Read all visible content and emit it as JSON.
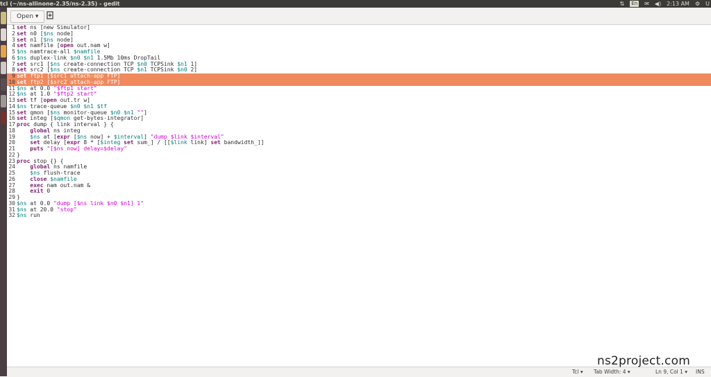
{
  "window": {
    "title": "tcl (~/ns-allinone-2.35/ns-2.35) - gedit"
  },
  "tray": {
    "clock": "2:13 AM",
    "lang": "En",
    "user": "U",
    "net_icon": "network-arrows-icon",
    "mail_icon": "mail-icon",
    "volume_icon": "volume-icon"
  },
  "toolbar": {
    "open_label": "Open ▾",
    "new_icon": "new-document-icon"
  },
  "editor": {
    "lines": [
      {
        "n": "1",
        "t": "set ns [new Simulator]"
      },
      {
        "n": "2",
        "t": "set n0 [$ns node]"
      },
      {
        "n": "3",
        "t": "set n1 [$ns node]"
      },
      {
        "n": "4",
        "t": "set namfile [open out.nam w]"
      },
      {
        "n": "5",
        "t": "$ns namtrace-all $namfile"
      },
      {
        "n": "6",
        "t": "$ns duplex-link $n0 $n1 1.5Mb 10ms DropTail"
      },
      {
        "n": "7",
        "t": "set src1 [$ns create-connection TCP $n0 TCPSink $n1 1]"
      },
      {
        "n": "8",
        "t": "set src2 [$ns create-connection TCP $n1 TCPSink $n0 2]"
      },
      {
        "n": "9",
        "t": "set ftp1 [$src1 attach-app FTP]"
      },
      {
        "n": "10",
        "t": "set ftp2 [$src2 attach-app FTP]"
      },
      {
        "n": "11",
        "t": "$ns at 0.0 \"$ftp1 start\""
      },
      {
        "n": "12",
        "t": "$ns at 1.0 \"$ftp2 start\""
      },
      {
        "n": "13",
        "t": "set tf [open out.tr w]"
      },
      {
        "n": "14",
        "t": "$ns trace-queue $n0 $n1 $tf"
      },
      {
        "n": "15",
        "t": "set qmon [$ns monitor-queue $n0 $n1 \"\"]"
      },
      {
        "n": "16",
        "t": "set integ [$qmon get-bytes-integrator]"
      },
      {
        "n": "17",
        "t": "proc dump { link interval } {"
      },
      {
        "n": "18",
        "t": "    global ns integ"
      },
      {
        "n": "19",
        "t": "    $ns at [expr [$ns now] + $interval] \"dump $link $interval\""
      },
      {
        "n": "20",
        "t": "    set delay [expr 8 * [$integ set sum_] / [[$link link] set bandwidth_]]"
      },
      {
        "n": "21",
        "t": "    puts \"[$ns now] delay=$delay\""
      },
      {
        "n": "22",
        "t": "}"
      },
      {
        "n": "23",
        "t": "proc stop {} {"
      },
      {
        "n": "24",
        "t": "    global ns namfile"
      },
      {
        "n": "25",
        "t": "    $ns flush-trace"
      },
      {
        "n": "26",
        "t": "    close $namfile"
      },
      {
        "n": "27",
        "t": "    exec nam out.nam &"
      },
      {
        "n": "28",
        "t": "    exit 0"
      },
      {
        "n": "29",
        "t": "}"
      },
      {
        "n": "30",
        "t": "$ns at 0.0 \"dump [$ns link $n0 $n1] 1\""
      },
      {
        "n": "31",
        "t": "$ns at 20.0 \"stop\""
      },
      {
        "n": "32",
        "t": "$ns run"
      }
    ],
    "current_line": 9,
    "selected_lines": [
      9,
      10
    ]
  },
  "statusbar": {
    "language": "Tcl ▾",
    "tab_width": "Tab Width: 4 ▾",
    "position": "Ln 9, Col 1 ▾",
    "mode": "INS"
  },
  "watermark": {
    "text": "ns2project.com"
  },
  "colors": {
    "highlight": "#f08a5d",
    "keyword": "#7c1d6f",
    "variable": "#008080",
    "string": "#d400d4"
  }
}
